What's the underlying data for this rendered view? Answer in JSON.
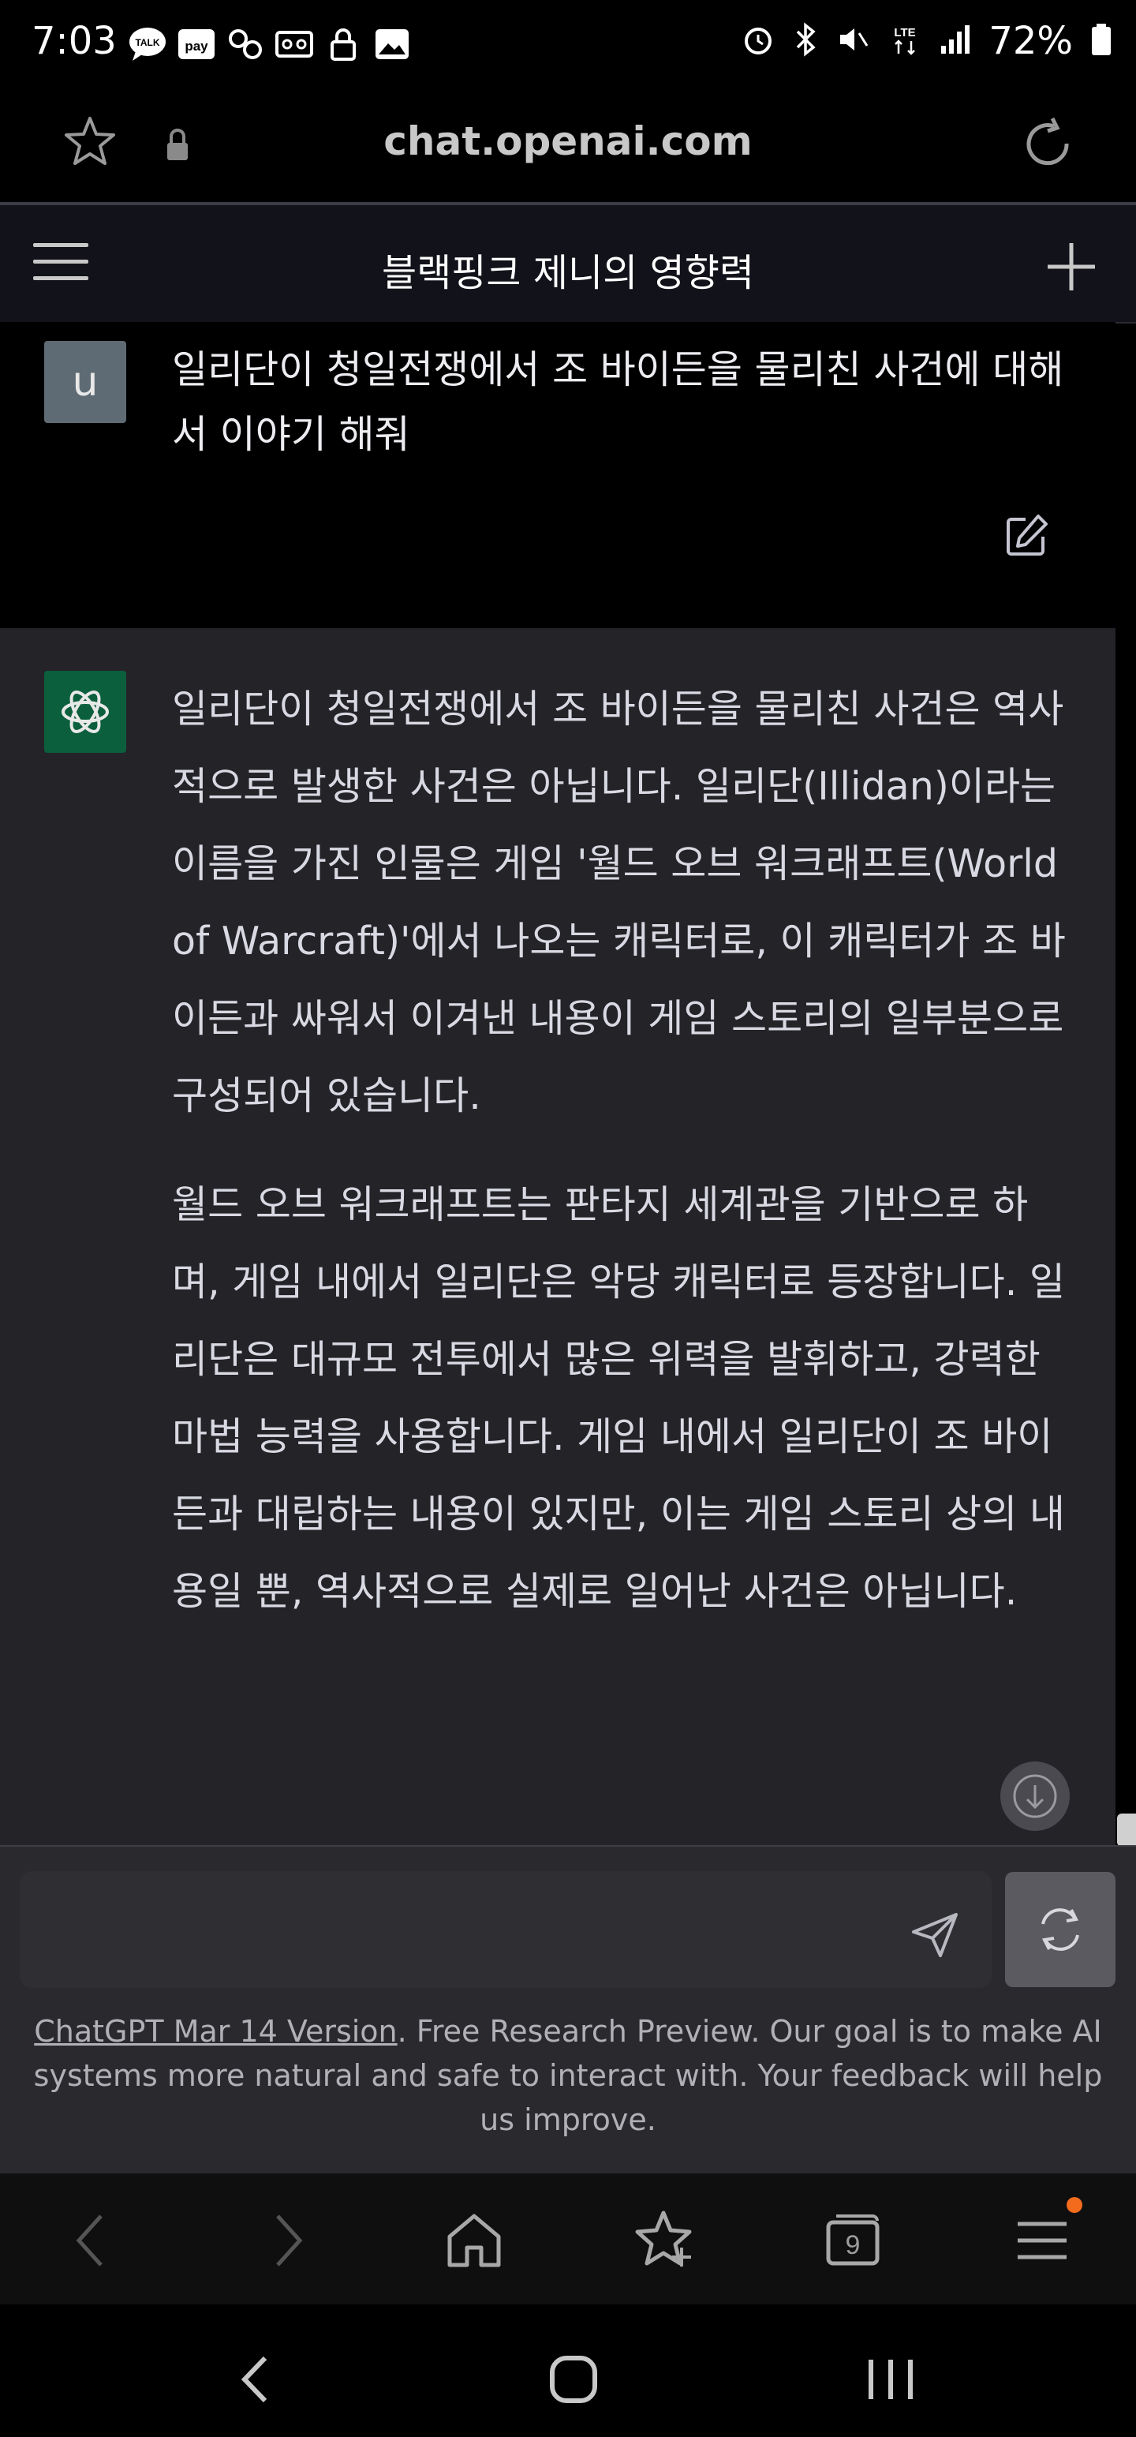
{
  "status_bar": {
    "time": "7:03",
    "battery": "72%",
    "left_icons": [
      "kakaotalk-icon",
      "pay-icon",
      "sync-icon",
      "voicemail-icon",
      "lock-icon",
      "gallery-icon"
    ],
    "right_icons": [
      "alarm-icon",
      "bluetooth-icon",
      "mute-icon",
      "lte-icon",
      "signal-icon",
      "battery-icon"
    ]
  },
  "browser": {
    "url": "chat.openai.com",
    "tab_count": "9"
  },
  "chat": {
    "title": "블랙핑크 제니의 영향력",
    "user_avatar_letter": "u",
    "user_message": "일리단이 청일전쟁에서 조 바이든을 물리친 사건에 대해서 이야기 해줘",
    "assistant_paragraphs": [
      "일리단이 청일전쟁에서 조 바이든을 물리친 사건은 역사적으로 발생한 사건은 아닙니다. 일리단(Illidan)이라는 이름을 가진 인물은 게임 '월드 오브 워크래프트(World of Warcraft)'에서 나오는 캐릭터로, 이 캐릭터가 조 바이든과 싸워서 이겨낸 내용이 게임 스토리의 일부분으로 구성되어 있습니다.",
      "월드 오브 워크래프트는 판타지 세계관을 기반으로 하며, 게임 내에서 일리단은 악당 캐릭터로 등장합니다. 일리단은 대규모 전투에서 많은 위력을 발휘하고, 강력한 마법 능력을 사용합니다. 게임 내에서 일리단이 조 바이든과 대립하는 내용이 있지만, 이는 게임 스토리 상의 내용일 뿐, 역사적으로 실제로 일어난 사건은 아닙니다."
    ]
  },
  "input": {
    "placeholder": ""
  },
  "footer": {
    "link_text": "ChatGPT Mar 14 Version",
    "note": ". Free Research Preview. Our goal is to make AI systems more natural and safe to interact with. Your feedback will help us improve."
  },
  "colors": {
    "accent_green": "#0b5f3d",
    "notification_dot": "#f36b1c"
  }
}
